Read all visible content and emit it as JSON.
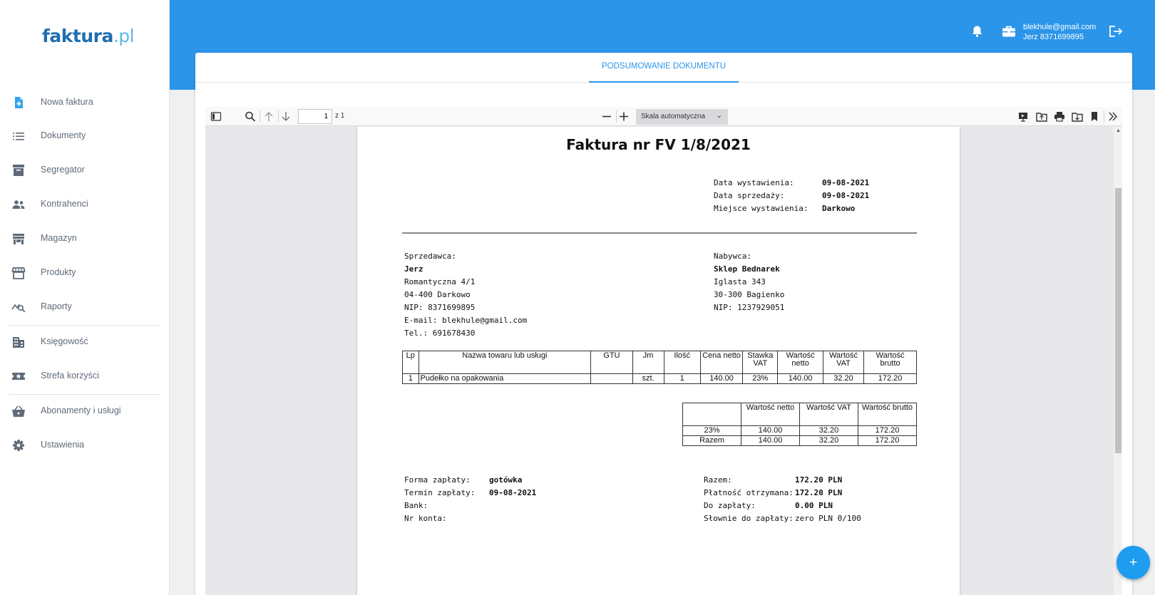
{
  "brand": {
    "part1": "faktura",
    "part2": ".pl"
  },
  "sidebar": {
    "items": [
      {
        "label": "Nowa faktura",
        "icon": "file-plus-icon"
      },
      {
        "label": "Dokumenty",
        "icon": "list-icon"
      },
      {
        "label": "Segregator",
        "icon": "archive-icon"
      },
      {
        "label": "Kontrahenci",
        "icon": "people-icon"
      },
      {
        "label": "Magazyn",
        "icon": "warehouse-icon"
      },
      {
        "label": "Produkty",
        "icon": "store-icon"
      },
      {
        "label": "Raporty",
        "icon": "report-search-icon"
      },
      {
        "label": "Księgowość",
        "icon": "building-icon"
      },
      {
        "label": "Strefa korzyści",
        "icon": "ticket-star-icon"
      },
      {
        "label": "Abonamenty i usługi",
        "icon": "basket-icon"
      },
      {
        "label": "Ustawienia",
        "icon": "gear-icon"
      }
    ]
  },
  "header": {
    "email": "blekhule@gmail.com",
    "company": "Jerz 8371699895"
  },
  "tabs": {
    "summary": "PODSUMOWANIE DOKUMENTU"
  },
  "viewer": {
    "page_value": "1",
    "page_of": "z 1",
    "zoom": "Skala automatyczna"
  },
  "invoice": {
    "title": "Faktura nr FV 1/8/2021",
    "meta": [
      {
        "label": "Data wystawienia:",
        "value": "09-08-2021"
      },
      {
        "label": "Data sprzedaży:",
        "value": "09-08-2021"
      },
      {
        "label": "Miejsce wystawienia:",
        "value": "Darkowo"
      }
    ],
    "seller": {
      "heading": "Sprzedawca:",
      "name": "Jerz",
      "lines": [
        "Romantyczna 4/1",
        "04-400 Darkowo",
        "NIP: 8371699895",
        "E-mail: blekhule@gmail.com",
        "Tel.: 691678430"
      ]
    },
    "buyer": {
      "heading": "Nabywca:",
      "name": "Sklep Bednarek",
      "lines": [
        "Iglasta 343",
        "30-300 Bagienko",
        "NIP: 1237929051"
      ]
    },
    "items_table": {
      "headers": [
        "Lp",
        "Nazwa towaru lub usługi",
        "GTU",
        "Jm",
        "Ilość",
        "Cena netto",
        "Stawka VAT",
        "Wartość netto",
        "Wartość VAT",
        "Wartość brutto"
      ],
      "rows": [
        [
          "1",
          "Pudełko na opakowania",
          "",
          "szt.",
          "1",
          "140.00",
          "23%",
          "140.00",
          "32.20",
          "172.20"
        ]
      ]
    },
    "summary_table": {
      "headers": [
        "",
        "Wartość netto",
        "Wartość VAT",
        "Wartość brutto"
      ],
      "rows": [
        [
          "23%",
          "140.00",
          "32.20",
          "172.20"
        ],
        [
          "Razem",
          "140.00",
          "32.20",
          "172.20"
        ]
      ]
    },
    "payment": [
      {
        "label": "Forma zapłaty:",
        "value": "gotówka"
      },
      {
        "label": "Termin zapłaty:",
        "value": "09-08-2021"
      },
      {
        "label": "Bank:",
        "value": ""
      },
      {
        "label": "Nr konta:",
        "value": ""
      }
    ],
    "totals": [
      {
        "label": "Razem:",
        "value": "172.20 PLN"
      },
      {
        "label": "Płatność otrzymana:",
        "value": "172.20 PLN"
      },
      {
        "label": "Do zapłaty:",
        "value": "0.00 PLN"
      },
      {
        "label": "Słownie do zapłaty:",
        "value": "zero PLN 0/100"
      }
    ]
  },
  "fab": {
    "label": "+"
  },
  "colors": {
    "primary": "#2b95e9",
    "sidebar_text": "#5f6b78",
    "fab": "#1e9cf0"
  }
}
